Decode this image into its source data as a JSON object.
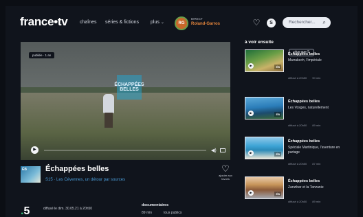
{
  "header": {
    "logo": "france•tv",
    "nav": [
      {
        "label": "chaînes"
      },
      {
        "label": "séries & fictions"
      },
      {
        "label": "plus"
      }
    ],
    "live_badge": "RG",
    "live_label": "DIRECT",
    "live_title": "Roland-Garros",
    "user_initial": "S",
    "search_placeholder": "Rechercher..."
  },
  "player": {
    "tag": "publiée · 1 an",
    "overlay_text": "ÉCHAPPÉES BELLES",
    "progress": 0
  },
  "programme": {
    "thumb_label": "ÉB",
    "title": "Échappées belles",
    "subtitle": "S15 · Les Cévennes, un détour par sources",
    "fav_label": "ajouter aux favoris",
    "channel": "5",
    "broadcast": "diffusé le dim. 30.05.21 à 20h50",
    "genre": "documentaires",
    "duration": "89 min",
    "audience": "tous publics"
  },
  "sidebar": {
    "title": "à voir ensuite",
    "see_more": "plus que 5",
    "items": [
      {
        "title": "Échappées belles",
        "subtitle": "Marrakech, l'impériale",
        "meta": "diffusé à 20h50",
        "duration": "90 min",
        "chip": "ÉB"
      },
      {
        "title": "Échappées belles",
        "subtitle": "Les Vosges, naturellement",
        "meta": "diffusé à 20h50",
        "duration": "89 min",
        "chip": "ÉB"
      },
      {
        "title": "Échappées belles",
        "subtitle": "Spéciale Martinique, l'aventure en partage",
        "meta": "diffusé à 20h50",
        "duration": "87 min",
        "chip": "ÉB"
      },
      {
        "title": "Échappées belles",
        "subtitle": "Zanzibar et la Tanzanie",
        "meta": "diffusé à 20h50",
        "duration": "89 min",
        "chip": "ÉB"
      }
    ]
  },
  "colors": {
    "background": "#10141c",
    "accent_live": "#e2843b",
    "subtitle_blue": "#4a9bd6",
    "channel_green": "#33c27a"
  },
  "icons": [
    "heart-icon",
    "user-icon",
    "search-icon",
    "play-icon",
    "volume-icon",
    "fullscreen-icon",
    "chevron-down-icon"
  ]
}
